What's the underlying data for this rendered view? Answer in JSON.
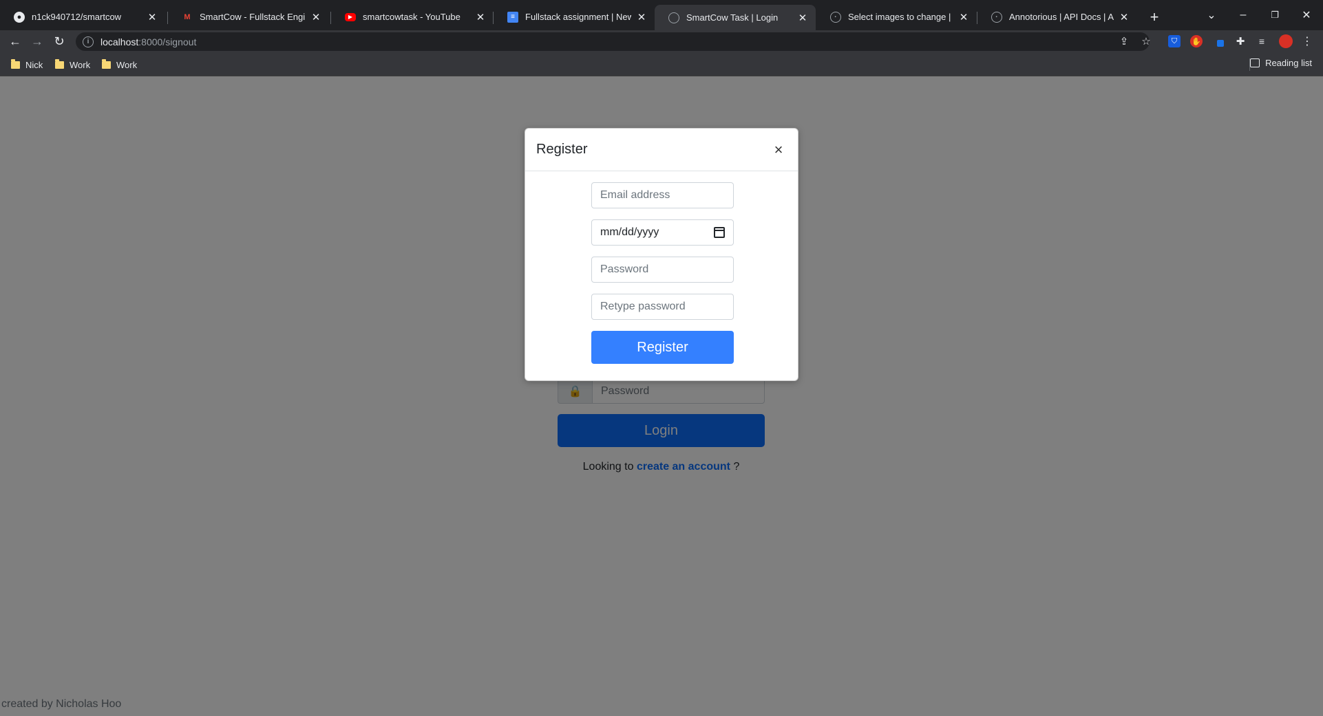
{
  "browser": {
    "tabs": [
      {
        "title": "n1ck940712/smartcow",
        "icon": "github-icon"
      },
      {
        "title": "SmartCow - Fullstack Engineer",
        "icon": "gmail-icon"
      },
      {
        "title": "smartcowtask - YouTube",
        "icon": "youtube-icon"
      },
      {
        "title": "Fullstack assignment | New - Go",
        "icon": "docs-icon"
      },
      {
        "title": "SmartCow Task | Login",
        "icon": "page-icon",
        "active": true
      },
      {
        "title": "Select images to change | Djang",
        "icon": "globe-icon"
      },
      {
        "title": "Annotorious | API Docs | Annot",
        "icon": "globe-icon"
      }
    ],
    "url_host": "localhost",
    "url_path": ":8000/signout",
    "bookmarks": [
      "Nick",
      "Work",
      "Work"
    ],
    "reading_list": "Reading list"
  },
  "login": {
    "password_placeholder": "Password",
    "login_label": "Login",
    "hint_prefix": "Looking to ",
    "hint_link": "create an account",
    "hint_suffix": " ?"
  },
  "footer": {
    "credit": "created by Nicholas Hoo"
  },
  "register_modal": {
    "title": "Register",
    "close": "×",
    "email_placeholder": "Email address",
    "date_placeholder": "mm/dd/yyyy",
    "password_placeholder": "Password",
    "retype_placeholder": "Retype password",
    "submit_label": "Register"
  }
}
